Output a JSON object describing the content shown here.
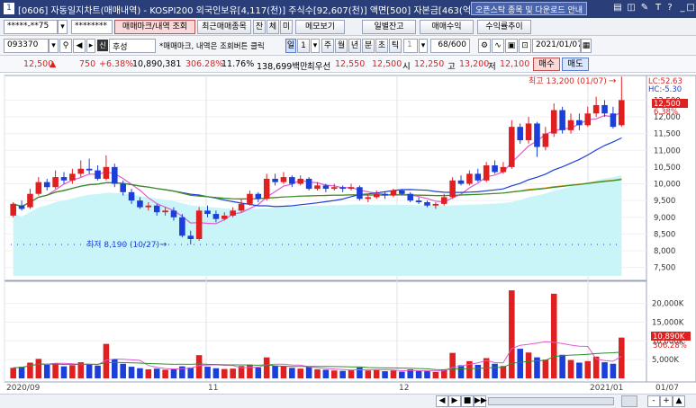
{
  "window": {
    "title": "[0606] 자동일지차트(매매내역) - KOSPI200 외국인보유[4,117(천)] 주식수[92,607(천)] 액면[500] 자본금[463(억)]",
    "banner_button": "오픈스탁 종목 및 다운로드 안내",
    "icons": [
      "window-list-icon",
      "copy-icon",
      "pin-icon",
      "text-size-icon",
      "help-icon",
      "minimize-icon",
      "maximize-icon",
      "close-icon"
    ]
  },
  "toolbar1": {
    "account": "*****-**75",
    "password": "********",
    "tabs": [
      "매매마크/내역 조회",
      "최근매매종목"
    ],
    "mini_buttons": [
      "잔",
      "체",
      "미"
    ],
    "memo_button": "메모보기",
    "right_buttons": [
      "일별잔고",
      "매매수익",
      "수익률추이"
    ]
  },
  "toolbar2": {
    "code": "093370",
    "stock_name": "후성",
    "stock_badge": "신",
    "notice": "*매매마크, 내역은 조회버튼 클릭",
    "periods": [
      "일",
      "1",
      "주",
      "월",
      "년",
      "분",
      "초",
      "틱"
    ],
    "interval_value": "1",
    "count_value": "68/600",
    "date_value": "2021/01/07"
  },
  "quote": {
    "price": "12,500",
    "arrow": "▲",
    "change": "750",
    "change_rate": "+6.38%",
    "volume": "10,890,381",
    "vol_ratio": "306.28%",
    "turnover": "11.76%",
    "amount": "138,699백만",
    "best_ask_label": "최우선",
    "best_ask": "12,550",
    "best_bid": "12,500",
    "open_label": "시",
    "open": "12,250",
    "high_label": "고",
    "high": "13,200",
    "low_label": "저",
    "low": "12,100",
    "buy_tab": "매수",
    "sell_tab": "매도"
  },
  "chart_data": {
    "type": "candlestick",
    "title": "",
    "price_axis": {
      "min": 7250,
      "max": 13100,
      "ticks": [
        "12,500",
        "12,000",
        "11,500",
        "11,000",
        "10,500",
        "10,000",
        "9,500",
        "9,000",
        "8,500",
        "8,000",
        "7,500"
      ]
    },
    "volume_axis": {
      "max": 24000,
      "ticks": [
        "20,000K",
        "15,000K",
        "10,000K",
        "5,000K"
      ]
    },
    "x_labels": [
      "2020/09",
      "11",
      "12",
      "2021/01"
    ],
    "right_x_label": "01/07",
    "annotations": {
      "high": "최고 13,200 (01/07)",
      "low": "최저 8,190 (10/27)",
      "lc": "LC:52.63",
      "hc": "HC:-5.30",
      "last_price": "12,500",
      "last_rate": "6.38%",
      "last_volume": "10,890K",
      "last_vol_ratio": "306.28%"
    },
    "candles": [
      {
        "o": 9050,
        "c": 9400,
        "h": 9450,
        "l": 9000,
        "v": 2800
      },
      {
        "o": 9350,
        "c": 9250,
        "h": 9500,
        "l": 9200,
        "v": 3100
      },
      {
        "o": 9300,
        "c": 9700,
        "h": 9850,
        "l": 9250,
        "v": 4200
      },
      {
        "o": 9700,
        "c": 10050,
        "h": 10200,
        "l": 9650,
        "v": 5200
      },
      {
        "o": 10050,
        "c": 9900,
        "h": 10150,
        "l": 9800,
        "v": 3600
      },
      {
        "o": 9900,
        "c": 10200,
        "h": 10400,
        "l": 9850,
        "v": 4000
      },
      {
        "o": 10200,
        "c": 10100,
        "h": 10350,
        "l": 10000,
        "v": 3200
      },
      {
        "o": 10100,
        "c": 10300,
        "h": 10450,
        "l": 10000,
        "v": 3500
      },
      {
        "o": 10300,
        "c": 10450,
        "h": 10700,
        "l": 10200,
        "v": 4300
      },
      {
        "o": 10450,
        "c": 10400,
        "h": 10750,
        "l": 10300,
        "v": 3800
      },
      {
        "o": 10400,
        "c": 10150,
        "h": 10550,
        "l": 10100,
        "v": 3400
      },
      {
        "o": 10150,
        "c": 10500,
        "h": 10850,
        "l": 10100,
        "v": 9200
      },
      {
        "o": 10500,
        "c": 10000,
        "h": 10600,
        "l": 9900,
        "v": 5100
      },
      {
        "o": 10000,
        "c": 9750,
        "h": 10100,
        "l": 9650,
        "v": 3900
      },
      {
        "o": 9750,
        "c": 9500,
        "h": 9850,
        "l": 9400,
        "v": 3100
      },
      {
        "o": 9500,
        "c": 9300,
        "h": 9600,
        "l": 9250,
        "v": 2700
      },
      {
        "o": 9300,
        "c": 9350,
        "h": 9450,
        "l": 9200,
        "v": 2400
      },
      {
        "o": 9350,
        "c": 9150,
        "h": 9400,
        "l": 9050,
        "v": 2600
      },
      {
        "o": 9150,
        "c": 9200,
        "h": 9300,
        "l": 9050,
        "v": 2300
      },
      {
        "o": 9200,
        "c": 9000,
        "h": 9300,
        "l": 8900,
        "v": 2500
      },
      {
        "o": 9000,
        "c": 8450,
        "h": 9100,
        "l": 8400,
        "v": 3200
      },
      {
        "o": 8450,
        "c": 8350,
        "h": 8600,
        "l": 8190,
        "v": 2900
      },
      {
        "o": 8350,
        "c": 9200,
        "h": 9300,
        "l": 8300,
        "v": 6200
      },
      {
        "o": 9200,
        "c": 9100,
        "h": 9350,
        "l": 9000,
        "v": 3100
      },
      {
        "o": 9100,
        "c": 8950,
        "h": 9200,
        "l": 8850,
        "v": 2700
      },
      {
        "o": 8950,
        "c": 9050,
        "h": 9150,
        "l": 8900,
        "v": 2500
      },
      {
        "o": 9050,
        "c": 9200,
        "h": 9300,
        "l": 9000,
        "v": 2600
      },
      {
        "o": 9200,
        "c": 9400,
        "h": 9550,
        "l": 9150,
        "v": 3300
      },
      {
        "o": 9400,
        "c": 9700,
        "h": 9800,
        "l": 9350,
        "v": 3700
      },
      {
        "o": 9700,
        "c": 9550,
        "h": 9750,
        "l": 9450,
        "v": 2900
      },
      {
        "o": 9550,
        "c": 10150,
        "h": 10300,
        "l": 9500,
        "v": 5600
      },
      {
        "o": 10150,
        "c": 10050,
        "h": 10300,
        "l": 9950,
        "v": 3400
      },
      {
        "o": 10050,
        "c": 10200,
        "h": 10350,
        "l": 10000,
        "v": 3200
      },
      {
        "o": 10200,
        "c": 10000,
        "h": 10250,
        "l": 9900,
        "v": 2800
      },
      {
        "o": 10000,
        "c": 10150,
        "h": 10250,
        "l": 9950,
        "v": 2600
      },
      {
        "o": 10150,
        "c": 9850,
        "h": 10200,
        "l": 9800,
        "v": 3100
      },
      {
        "o": 9850,
        "c": 9950,
        "h": 10050,
        "l": 9800,
        "v": 2400
      },
      {
        "o": 9950,
        "c": 9850,
        "h": 10000,
        "l": 9750,
        "v": 2300
      },
      {
        "o": 9850,
        "c": 9900,
        "h": 10000,
        "l": 9800,
        "v": 2100
      },
      {
        "o": 9900,
        "c": 9850,
        "h": 9950,
        "l": 9750,
        "v": 2000
      },
      {
        "o": 9850,
        "c": 9900,
        "h": 10000,
        "l": 9800,
        "v": 2200
      },
      {
        "o": 9900,
        "c": 9550,
        "h": 9950,
        "l": 9500,
        "v": 2900
      },
      {
        "o": 9550,
        "c": 9600,
        "h": 9700,
        "l": 9450,
        "v": 2100
      },
      {
        "o": 9600,
        "c": 9700,
        "h": 9800,
        "l": 9550,
        "v": 2300
      },
      {
        "o": 9700,
        "c": 9650,
        "h": 9750,
        "l": 9550,
        "v": 1900
      },
      {
        "o": 9650,
        "c": 9800,
        "h": 9850,
        "l": 9600,
        "v": 2100
      },
      {
        "o": 9800,
        "c": 9700,
        "h": 9850,
        "l": 9650,
        "v": 1800
      },
      {
        "o": 9700,
        "c": 9500,
        "h": 9750,
        "l": 9450,
        "v": 2400
      },
      {
        "o": 9500,
        "c": 9450,
        "h": 9600,
        "l": 9400,
        "v": 2000
      },
      {
        "o": 9450,
        "c": 9350,
        "h": 9500,
        "l": 9300,
        "v": 1900
      },
      {
        "o": 9350,
        "c": 9400,
        "h": 9450,
        "l": 9250,
        "v": 1700
      },
      {
        "o": 9400,
        "c": 9600,
        "h": 9700,
        "l": 9350,
        "v": 2300
      },
      {
        "o": 9600,
        "c": 10100,
        "h": 10200,
        "l": 9550,
        "v": 6800
      },
      {
        "o": 10100,
        "c": 10000,
        "h": 10250,
        "l": 9950,
        "v": 3500
      },
      {
        "o": 10000,
        "c": 10300,
        "h": 10400,
        "l": 9950,
        "v": 4600
      },
      {
        "o": 10300,
        "c": 10100,
        "h": 10450,
        "l": 10050,
        "v": 3600
      },
      {
        "o": 10100,
        "c": 10550,
        "h": 10650,
        "l": 10050,
        "v": 5400
      },
      {
        "o": 10550,
        "c": 10350,
        "h": 10700,
        "l": 10300,
        "v": 3900
      },
      {
        "o": 10350,
        "c": 10500,
        "h": 10650,
        "l": 10300,
        "v": 3300
      },
      {
        "o": 10500,
        "c": 11700,
        "h": 11900,
        "l": 10450,
        "v": 23500
      },
      {
        "o": 11700,
        "c": 11300,
        "h": 11800,
        "l": 11200,
        "v": 7900
      },
      {
        "o": 11300,
        "c": 11800,
        "h": 12000,
        "l": 11200,
        "v": 6900
      },
      {
        "o": 11800,
        "c": 11100,
        "h": 11850,
        "l": 10800,
        "v": 5600
      },
      {
        "o": 11100,
        "c": 11500,
        "h": 11700,
        "l": 11000,
        "v": 5000
      },
      {
        "o": 11500,
        "c": 12200,
        "h": 12400,
        "l": 11400,
        "v": 22600
      },
      {
        "o": 12200,
        "c": 11600,
        "h": 12300,
        "l": 11500,
        "v": 6300
      },
      {
        "o": 11600,
        "c": 11900,
        "h": 12100,
        "l": 11500,
        "v": 4900
      },
      {
        "o": 11900,
        "c": 11750,
        "h": 12100,
        "l": 11600,
        "v": 4200
      },
      {
        "o": 11750,
        "c": 12100,
        "h": 12300,
        "l": 11700,
        "v": 4600
      },
      {
        "o": 12100,
        "c": 12350,
        "h": 12600,
        "l": 12000,
        "v": 5800
      },
      {
        "o": 12350,
        "c": 12100,
        "h": 12500,
        "l": 12000,
        "v": 4300
      },
      {
        "o": 12100,
        "c": 11700,
        "h": 12300,
        "l": 11650,
        "v": 3900
      },
      {
        "o": 11750,
        "c": 12500,
        "h": 13200,
        "l": 11700,
        "v": 10890
      }
    ],
    "volume_dots": []
  },
  "bottom": {
    "buttons": [
      "◀",
      "▶",
      "◀◀",
      "■",
      "▶▶",
      "-",
      "+",
      "▲"
    ]
  }
}
